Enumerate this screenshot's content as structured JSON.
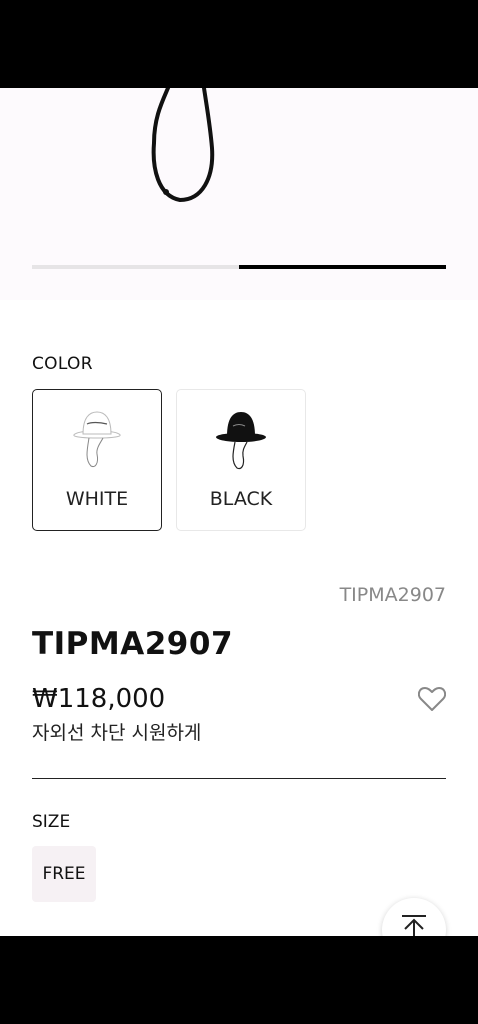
{
  "gallery": {
    "progress": {
      "start_fraction": 0.5,
      "end_fraction": 1.0
    }
  },
  "color": {
    "label": "COLOR",
    "options": [
      {
        "label": "WHITE",
        "selected": true,
        "hat_color": "#ffffff"
      },
      {
        "label": "BLACK",
        "selected": false,
        "hat_color": "#111111"
      }
    ]
  },
  "product": {
    "code": "TIPMA2907",
    "name": "TIPMA2907",
    "price": "₩118,000",
    "subtitle": "자외선 차단 시원하게",
    "wishlist_icon": "heart-outline-icon"
  },
  "size": {
    "label": "SIZE",
    "options": [
      "FREE"
    ]
  },
  "scroll_top_icon": "arrow-up-to-top-icon",
  "colors": {
    "accent": "#000000",
    "gallery_bg": "#fdfafd",
    "size_chip_bg": "#f6f1f4",
    "muted_text": "#888888"
  }
}
